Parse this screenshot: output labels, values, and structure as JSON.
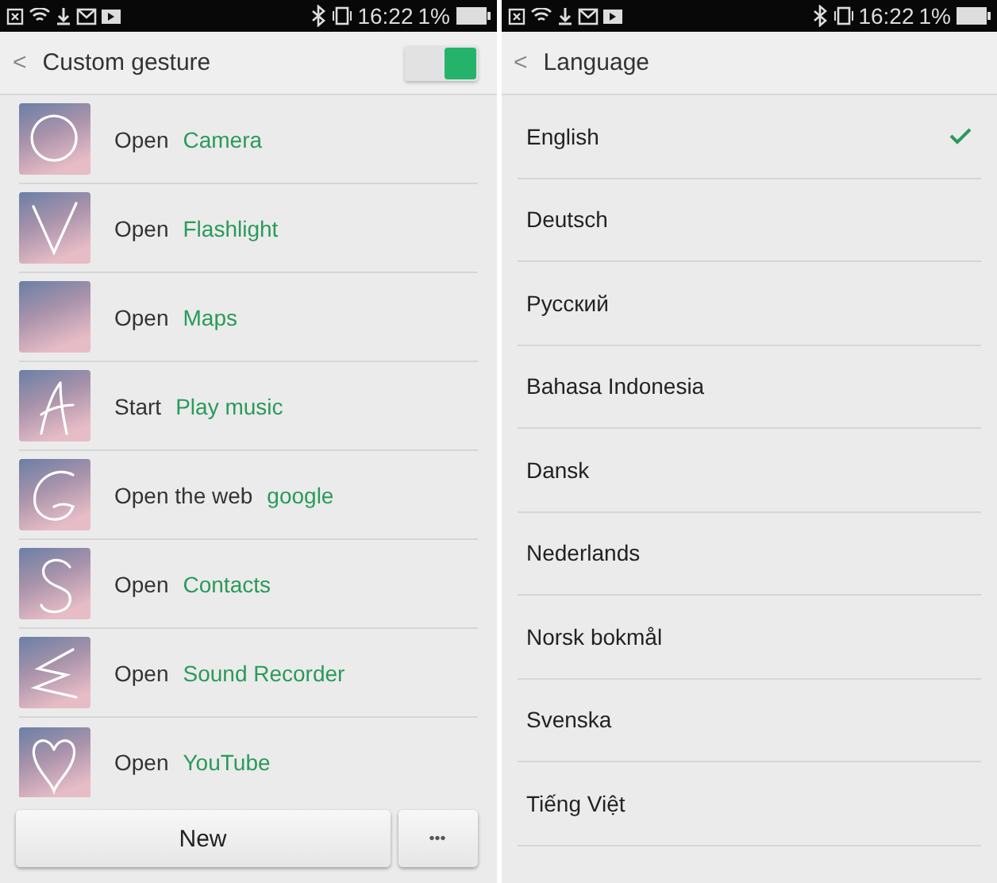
{
  "panels": [
    {
      "status_bar": {
        "time": "16:22",
        "battery": "1%"
      },
      "header": {
        "back": "<",
        "title": "Custom gesture",
        "toggle": {
          "on": true
        }
      },
      "gestures": [
        {
          "verb": "Open",
          "target": "Camera"
        },
        {
          "verb": "Open",
          "target": "Flashlight"
        },
        {
          "verb": "Open",
          "target": "Maps"
        },
        {
          "verb": "Start",
          "target": "Play music"
        },
        {
          "verb": "Open the web",
          "target": "google"
        },
        {
          "verb": "Open",
          "target": "Contacts"
        },
        {
          "verb": "Open",
          "target": "Sound Recorder"
        },
        {
          "verb": "Open",
          "target": "YouTube"
        }
      ],
      "buttons": [
        {
          "kind": "text",
          "label": "New"
        },
        {
          "kind": "dots",
          "label": "•••"
        }
      ]
    },
    {
      "status_bar": {
        "time": "16:22",
        "battery": "1%"
      },
      "header": {
        "back": "<",
        "title": "Language"
      },
      "languages": [
        {
          "label": "English",
          "selected": true
        },
        {
          "label": "Deutsch",
          "selected": false
        },
        {
          "label": "Русский",
          "selected": false
        },
        {
          "label": "Bahasa Indonesia",
          "selected": false
        },
        {
          "label": "Dansk",
          "selected": false
        },
        {
          "label": "Nederlands",
          "selected": false
        },
        {
          "label": "Norsk bokmål",
          "selected": false
        },
        {
          "label": "Svenska",
          "selected": false
        },
        {
          "label": "Tiếng Việt",
          "selected": false
        }
      ]
    }
  ]
}
